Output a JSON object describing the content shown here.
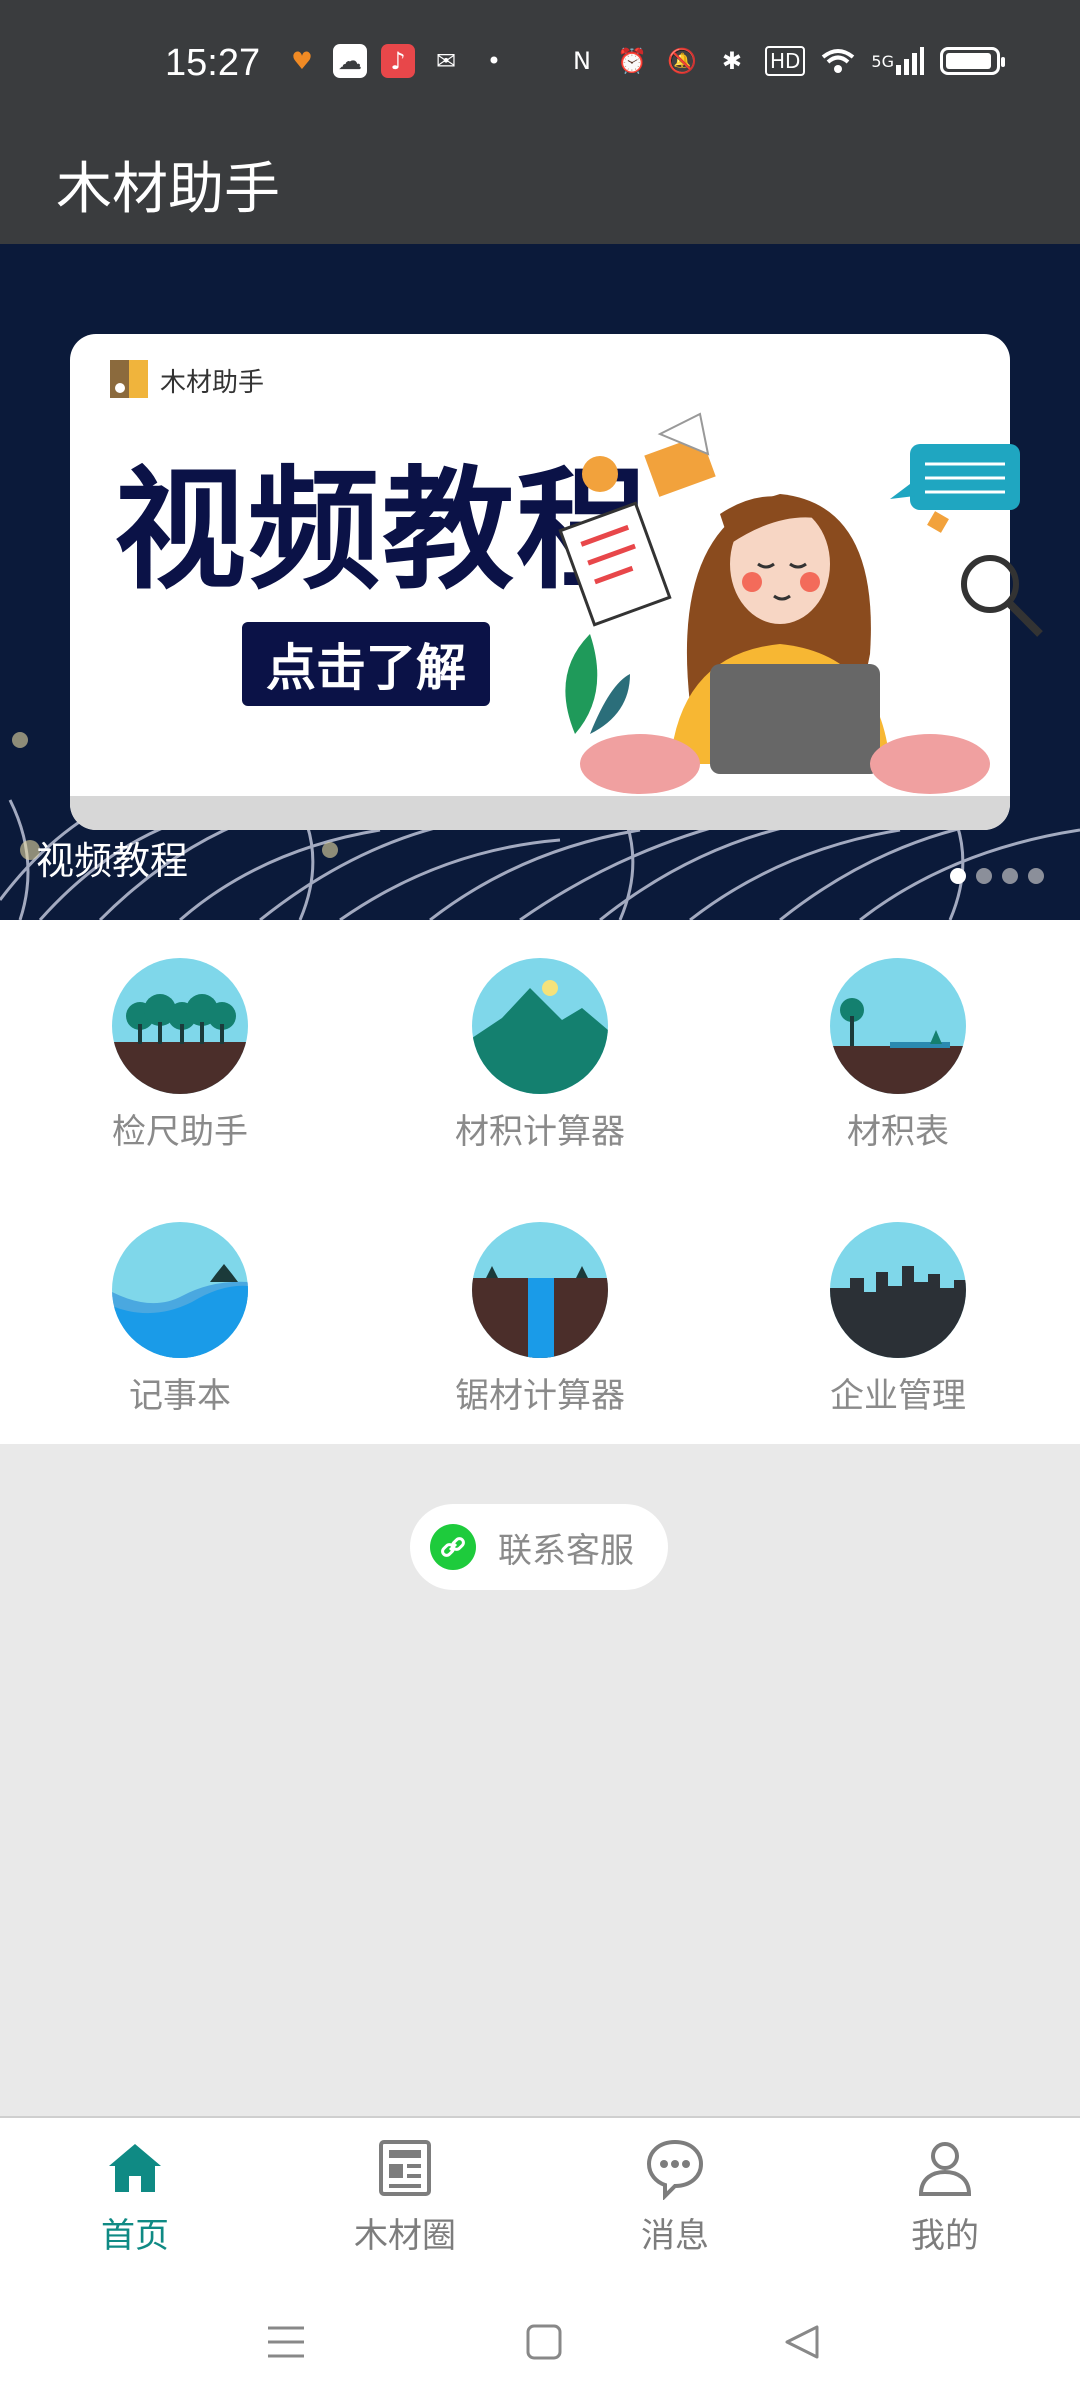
{
  "status_bar": {
    "time": "15:27",
    "left_icons": [
      "heart-app-icon",
      "cloud-app-icon",
      "music-app-icon",
      "wechat-icon",
      "dot-icon"
    ],
    "right_icons": [
      "nfc-icon",
      "alarm-icon",
      "mute-icon",
      "bluetooth-icon",
      "hd-icon",
      "wifi-icon",
      "signal-5g-icon",
      "battery-icon"
    ],
    "hd_text": "HD",
    "signal_text": "5G"
  },
  "app_bar": {
    "title": "木材助手"
  },
  "banner": {
    "card_brand": "木材助手",
    "headline": "视频教程",
    "cta": "点击了解",
    "caption": "视频教程",
    "slide_count": 4,
    "active_slide": 1
  },
  "tools": [
    {
      "label": "检尺助手",
      "icon": "forest-icon"
    },
    {
      "label": "材积计算器",
      "icon": "mountain-icon"
    },
    {
      "label": "材积表",
      "icon": "tree-lake-icon"
    },
    {
      "label": "记事本",
      "icon": "wave-icon"
    },
    {
      "label": "锯材计算器",
      "icon": "waterfall-icon"
    },
    {
      "label": "企业管理",
      "icon": "city-icon"
    }
  ],
  "contact": {
    "label": "联系客服",
    "icon": "link-icon"
  },
  "bottom_nav": [
    {
      "label": "首页",
      "icon": "home-icon",
      "active": true
    },
    {
      "label": "木材圈",
      "icon": "news-icon",
      "active": false
    },
    {
      "label": "消息",
      "icon": "chat-icon",
      "active": false
    },
    {
      "label": "我的",
      "icon": "profile-icon",
      "active": false
    }
  ],
  "colors": {
    "bar": "#3a3c3e",
    "accent": "#0f8a84",
    "banner_bg": "#0b1a3a",
    "tile_sky": "#7fd7ea",
    "contact_icon": "#1ecb3c"
  }
}
